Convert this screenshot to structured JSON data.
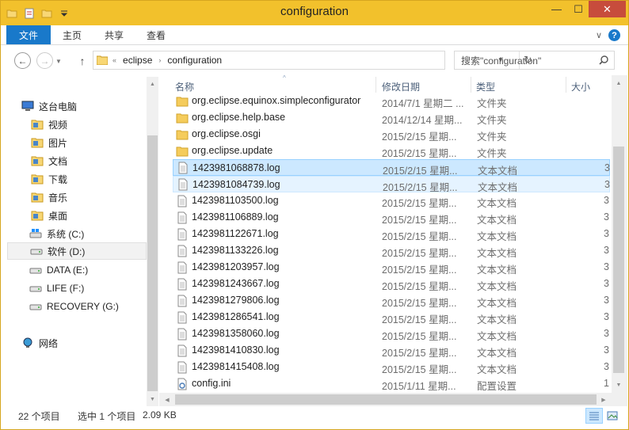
{
  "window": {
    "title": "configuration",
    "minimize": "—",
    "maximize": "☐",
    "close": "✕"
  },
  "ribbon": {
    "tabs": {
      "file": "文件",
      "home": "主页",
      "share": "共享",
      "view": "查看"
    },
    "expand": "∨",
    "help": "?"
  },
  "nav": {
    "back": "←",
    "forward": "→",
    "recent": "▼",
    "up": "↑",
    "refresh": "↻",
    "address": {
      "overflow": "«",
      "crumbs": [
        "eclipse",
        "configuration"
      ],
      "separator": "›",
      "dropdown": "▼"
    },
    "search_placeholder": "搜索\"configuration\""
  },
  "sidebar": {
    "items": [
      {
        "label": "这台电脑",
        "icon": "computer-icon"
      },
      {
        "label": "视频",
        "icon": "videos-folder-icon"
      },
      {
        "label": "图片",
        "icon": "pictures-folder-icon"
      },
      {
        "label": "文档",
        "icon": "documents-folder-icon"
      },
      {
        "label": "下载",
        "icon": "downloads-folder-icon"
      },
      {
        "label": "音乐",
        "icon": "music-folder-icon"
      },
      {
        "label": "桌面",
        "icon": "desktop-folder-icon"
      },
      {
        "label": "系统 (C:)",
        "icon": "system-drive-icon"
      },
      {
        "label": "软件 (D:)",
        "icon": "drive-icon",
        "selected": true
      },
      {
        "label": "DATA (E:)",
        "icon": "drive-icon"
      },
      {
        "label": "LIFE (F:)",
        "icon": "drive-icon"
      },
      {
        "label": "RECOVERY (G:)",
        "icon": "drive-icon"
      },
      {
        "label": "网络",
        "icon": "network-icon"
      }
    ]
  },
  "columns": {
    "name": "名称",
    "date": "修改日期",
    "type": "类型",
    "size": "大小",
    "sort_indicator": "^"
  },
  "files": [
    {
      "name": "org.eclipse.equinox.simpleconfigurator",
      "date": "2014/7/1 星期二 ...",
      "type": "文件夹",
      "size": "",
      "kind": "folder"
    },
    {
      "name": "org.eclipse.help.base",
      "date": "2014/12/14 星期...",
      "type": "文件夹",
      "size": "",
      "kind": "folder"
    },
    {
      "name": "org.eclipse.osgi",
      "date": "2015/2/15 星期...",
      "type": "文件夹",
      "size": "",
      "kind": "folder"
    },
    {
      "name": "org.eclipse.update",
      "date": "2015/2/15 星期...",
      "type": "文件夹",
      "size": "",
      "kind": "folder"
    },
    {
      "name": "1423981068878.log",
      "date": "2015/2/15 星期...",
      "type": "文本文档",
      "size": "3",
      "kind": "text",
      "state": "sel"
    },
    {
      "name": "1423981084739.log",
      "date": "2015/2/15 星期...",
      "type": "文本文档",
      "size": "3",
      "kind": "text",
      "state": "hover"
    },
    {
      "name": "1423981103500.log",
      "date": "2015/2/15 星期...",
      "type": "文本文档",
      "size": "3",
      "kind": "text"
    },
    {
      "name": "1423981106889.log",
      "date": "2015/2/15 星期...",
      "type": "文本文档",
      "size": "3",
      "kind": "text"
    },
    {
      "name": "1423981122671.log",
      "date": "2015/2/15 星期...",
      "type": "文本文档",
      "size": "3",
      "kind": "text"
    },
    {
      "name": "1423981133226.log",
      "date": "2015/2/15 星期...",
      "type": "文本文档",
      "size": "3",
      "kind": "text"
    },
    {
      "name": "1423981203957.log",
      "date": "2015/2/15 星期...",
      "type": "文本文档",
      "size": "3",
      "kind": "text"
    },
    {
      "name": "1423981243667.log",
      "date": "2015/2/15 星期...",
      "type": "文本文档",
      "size": "3",
      "kind": "text"
    },
    {
      "name": "1423981279806.log",
      "date": "2015/2/15 星期...",
      "type": "文本文档",
      "size": "3",
      "kind": "text"
    },
    {
      "name": "1423981286541.log",
      "date": "2015/2/15 星期...",
      "type": "文本文档",
      "size": "3",
      "kind": "text"
    },
    {
      "name": "1423981358060.log",
      "date": "2015/2/15 星期...",
      "type": "文本文档",
      "size": "3",
      "kind": "text"
    },
    {
      "name": "1423981410830.log",
      "date": "2015/2/15 星期...",
      "type": "文本文档",
      "size": "3",
      "kind": "text"
    },
    {
      "name": "1423981415408.log",
      "date": "2015/2/15 星期...",
      "type": "文本文档",
      "size": "3",
      "kind": "text"
    },
    {
      "name": "config.ini",
      "date": "2015/1/11 星期...",
      "type": "配置设置",
      "size": "1",
      "kind": "config"
    }
  ],
  "status": {
    "count": "22 个项目",
    "selection": "选中 1 个项目",
    "size": "2.09 KB"
  },
  "scroll": {
    "up": "▲",
    "down": "▼",
    "left": "◀",
    "right": "▶"
  },
  "colors": {
    "titlebar": "#f2c12c",
    "file_tab": "#1979ca",
    "close": "#c74c3c",
    "selection": "#cce8ff",
    "folder": "#e8b83a"
  }
}
